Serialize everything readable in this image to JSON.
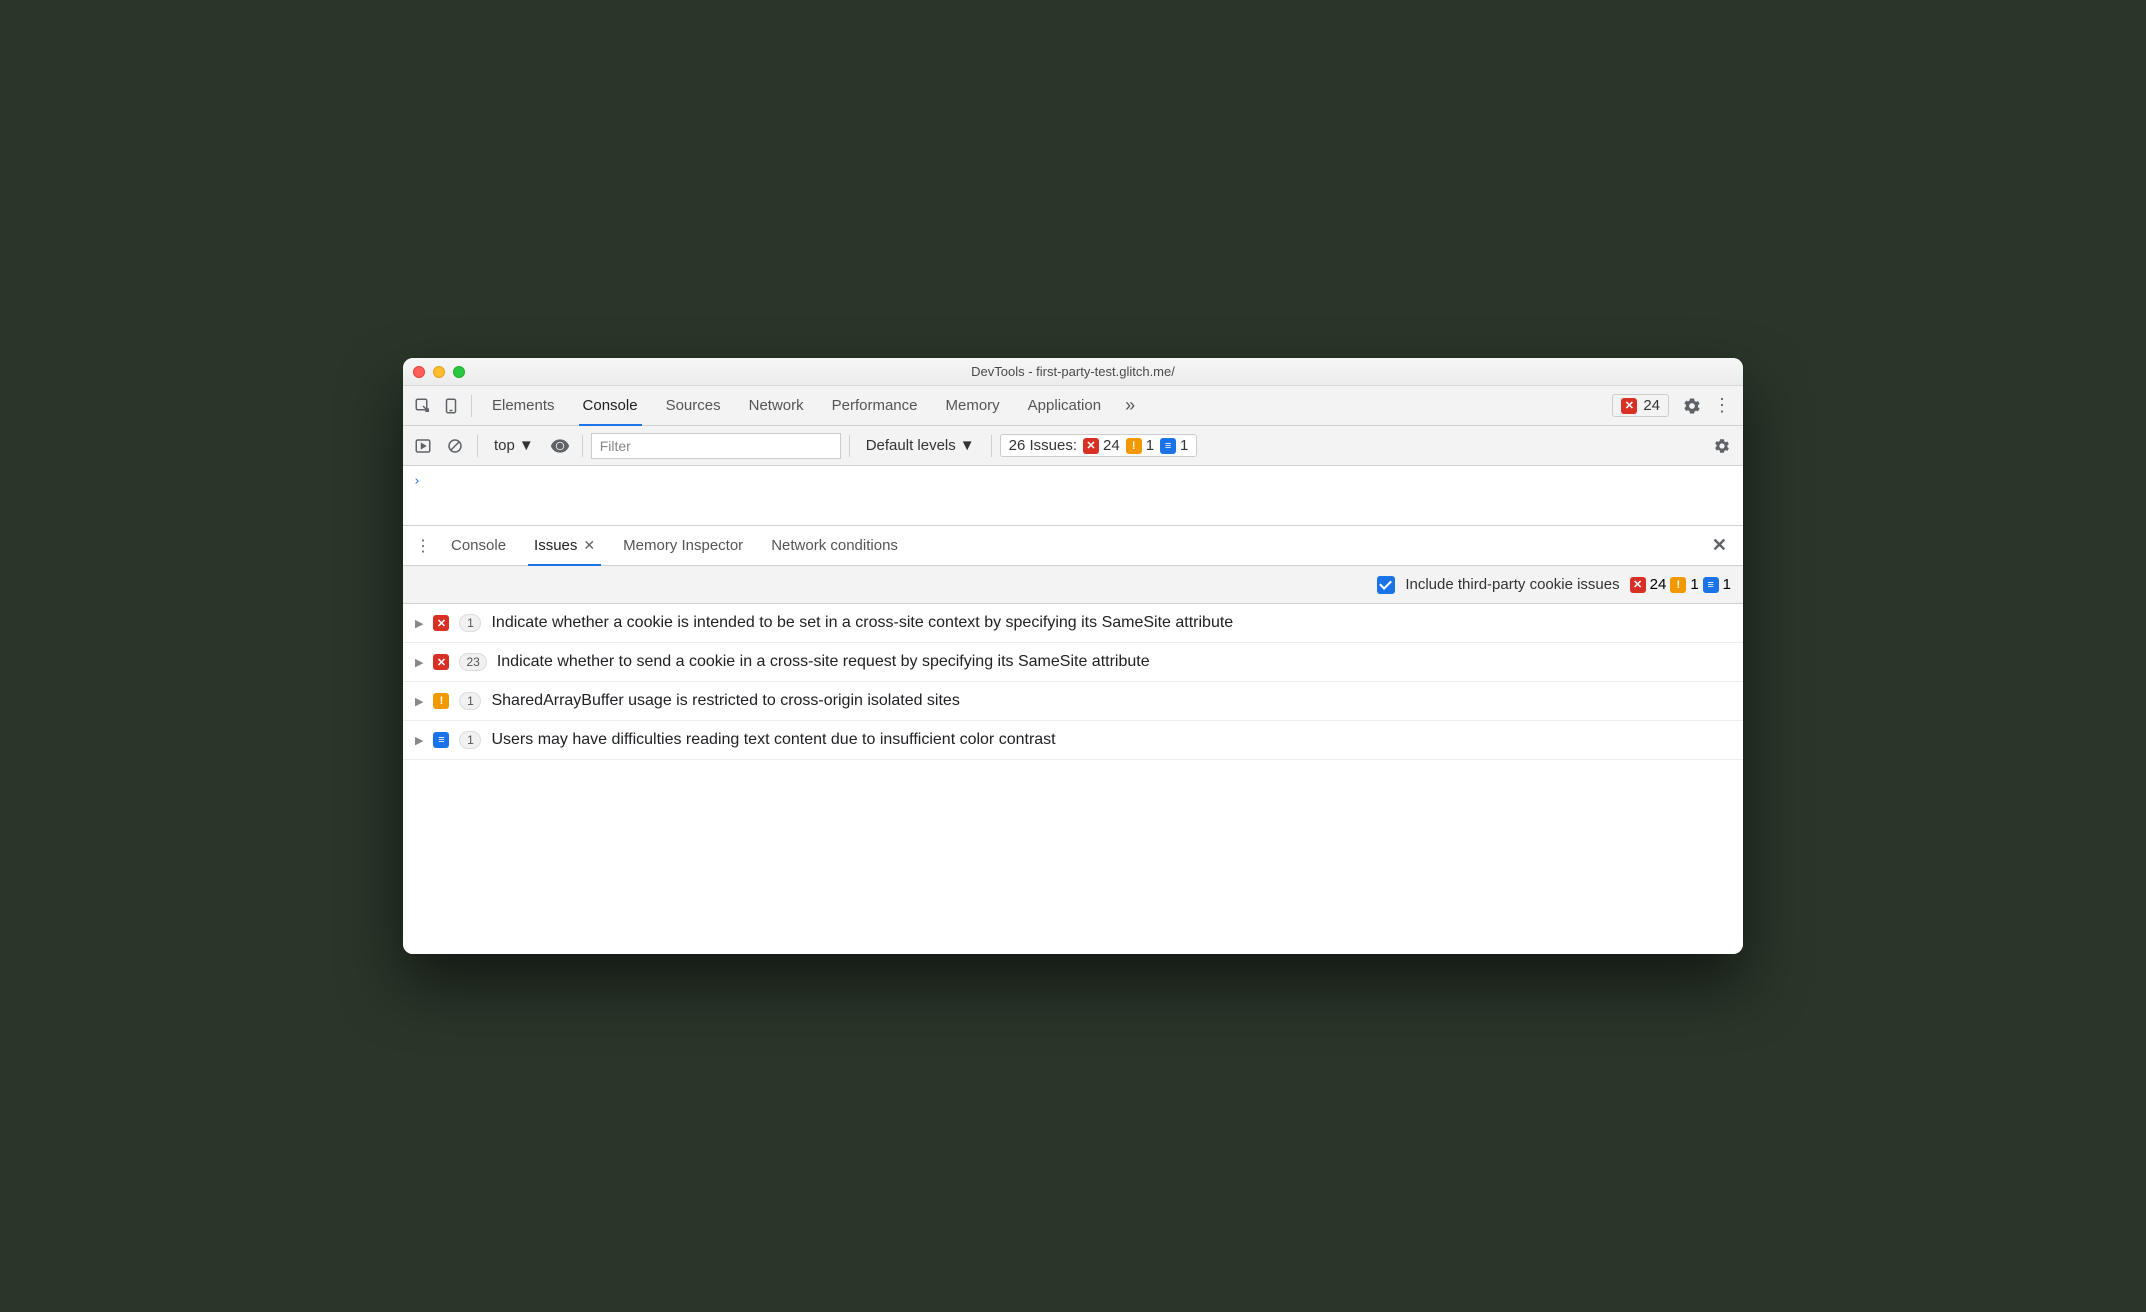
{
  "window": {
    "title": "DevTools - first-party-test.glitch.me/"
  },
  "main_tabs": {
    "items": [
      "Elements",
      "Console",
      "Sources",
      "Network",
      "Performance",
      "Memory",
      "Application"
    ],
    "active_index": 1
  },
  "top_badge": {
    "error_count": "24"
  },
  "console_toolbar": {
    "context": "top",
    "filter_placeholder": "Filter",
    "levels_label": "Default levels",
    "issues_label": "26 Issues:",
    "issues": {
      "errors": "24",
      "warnings": "1",
      "info": "1"
    }
  },
  "console_prompt": "›",
  "drawer_tabs": {
    "items": [
      "Console",
      "Issues",
      "Memory Inspector",
      "Network conditions"
    ],
    "active_index": 1
  },
  "issues_filter": {
    "checkbox_label": "Include third-party cookie issues",
    "checked": true,
    "counts": {
      "errors": "24",
      "warnings": "1",
      "info": "1"
    }
  },
  "issues": [
    {
      "kind": "err",
      "count": "1",
      "title": "Indicate whether a cookie is intended to be set in a cross-site context by specifying its SameSite attribute"
    },
    {
      "kind": "err",
      "count": "23",
      "title": "Indicate whether to send a cookie in a cross-site request by specifying its SameSite attribute"
    },
    {
      "kind": "warn",
      "count": "1",
      "title": "SharedArrayBuffer usage is restricted to cross-origin isolated sites"
    },
    {
      "kind": "info",
      "count": "1",
      "title": "Users may have difficulties reading text content due to insufficient color contrast"
    }
  ]
}
